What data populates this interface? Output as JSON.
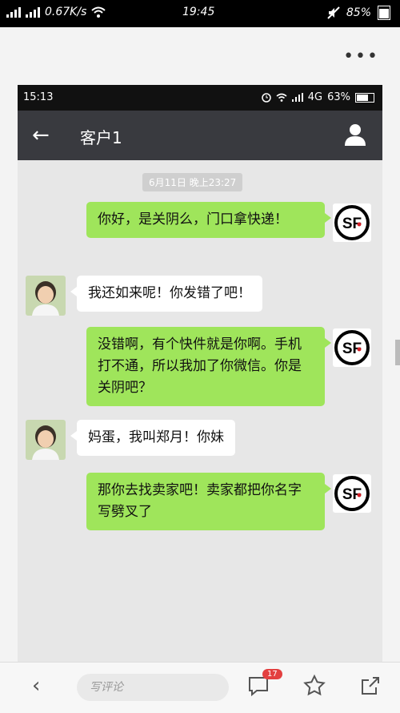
{
  "outer_status": {
    "speed": "0.67K/s",
    "time": "19:45",
    "battery": "85%"
  },
  "screenshot": {
    "status": {
      "time": "15:13",
      "network": "4G",
      "battery": "63%"
    },
    "title": "客户1",
    "timestamp": "6月11日 晚上23:27",
    "messages": [
      {
        "side": "right",
        "text": "你好，是关阴么，门口拿快递！"
      },
      {
        "side": "left",
        "text": "我还如来呢！你发错了吧！"
      },
      {
        "side": "right",
        "text": "没错啊，有个快件就是你啊。手机打不通，所以我加了你微信。你是关阴吧？"
      },
      {
        "side": "left",
        "text": "妈蛋，我叫郑月！你妹"
      },
      {
        "side": "right",
        "text": "那你去找卖家吧！卖家都把你名字写劈叉了"
      }
    ],
    "sender_avatar_label": "SF"
  },
  "bottom": {
    "comment_placeholder": "写评论",
    "badge_count": "17"
  },
  "colors": {
    "sent_bubble": "#9fe55b",
    "titlebar": "#393a3f",
    "sf_red": "#d21f26"
  }
}
